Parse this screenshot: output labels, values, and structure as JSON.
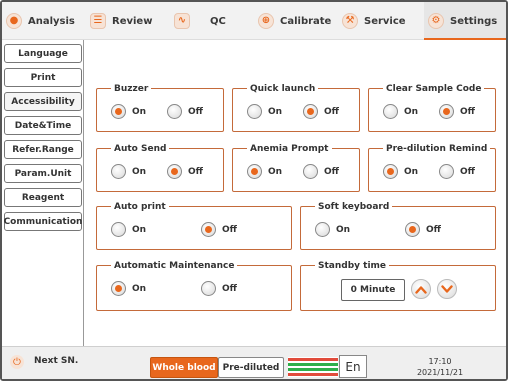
{
  "nav": {
    "items": [
      {
        "label": "Analysis",
        "icon": "analysis-icon"
      },
      {
        "label": "Review",
        "icon": "review-icon"
      },
      {
        "label": "QC",
        "icon": "qc-icon"
      },
      {
        "label": "Calibrate",
        "icon": "calibrate-icon"
      },
      {
        "label": "Service",
        "icon": "wrench-icon"
      },
      {
        "label": "Settings",
        "icon": "gear-icon",
        "active": true
      }
    ]
  },
  "sidebar": {
    "items": [
      {
        "label": "Language"
      },
      {
        "label": "Print"
      },
      {
        "label": "Accessibility",
        "active": true
      },
      {
        "label": "Date&Time"
      },
      {
        "label": "Refer.Range"
      },
      {
        "label": "Param.Unit"
      },
      {
        "label": "Reagent"
      },
      {
        "label": "Communication"
      }
    ]
  },
  "settings": {
    "buzzer": {
      "title": "Buzzer",
      "on": "On",
      "off": "Off",
      "selected": "On"
    },
    "quick_launch": {
      "title": "Quick launch",
      "on": "On",
      "off": "Off",
      "selected": "Off"
    },
    "clear_sample_code": {
      "title": "Clear Sample Code",
      "on": "On",
      "off": "Off",
      "selected": "Off"
    },
    "auto_send": {
      "title": "Auto Send",
      "on": "On",
      "off": "Off",
      "selected": "Off"
    },
    "anemia_prompt": {
      "title": "Anemia Prompt",
      "on": "On",
      "off": "Off",
      "selected": "On"
    },
    "pre_dilution_remind": {
      "title": "Pre-dilution Remind",
      "on": "On",
      "off": "Off",
      "selected": "On"
    },
    "auto_print": {
      "title": "Auto print",
      "on": "On",
      "off": "Off",
      "selected": "Off"
    },
    "soft_keyboard": {
      "title": "Soft keyboard",
      "on": "On",
      "off": "Off",
      "selected": "Off"
    },
    "automatic_maintenance": {
      "title": "Automatic Maintenance",
      "on": "On",
      "off": "Off",
      "selected": "On"
    },
    "standby_time": {
      "title": "Standby time",
      "value": "0 Minute"
    }
  },
  "bottom": {
    "next_sn": "Next SN.",
    "whole_blood": "Whole blood",
    "pre_diluted": "Pre-diluted",
    "language": "En",
    "time": "17:10",
    "date": "2021/11/21",
    "status_colors": [
      "#e14b3b",
      "#2fae4b",
      "#2fae4b",
      "#e14b3b"
    ]
  },
  "colors": {
    "accent": "#e8671d"
  }
}
